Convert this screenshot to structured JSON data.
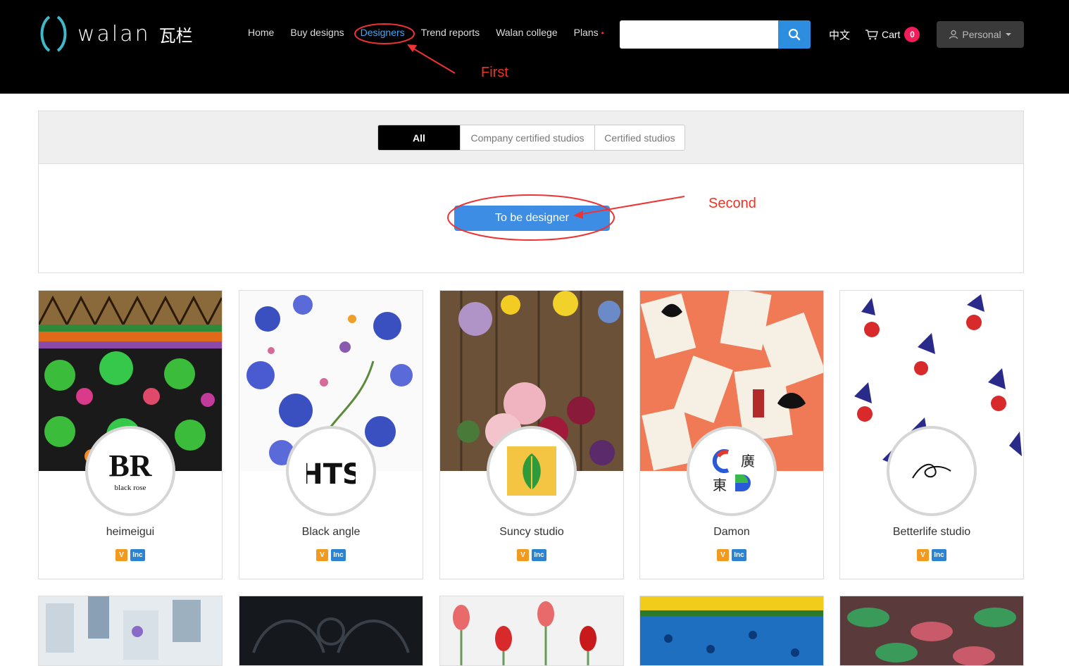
{
  "header": {
    "logo_text": "walan",
    "logo_cn": "瓦栏",
    "nav": [
      {
        "label": "Home"
      },
      {
        "label": "Buy designs"
      },
      {
        "label": "Designers"
      },
      {
        "label": "Trend reports"
      },
      {
        "label": "Walan college"
      },
      {
        "label": "Plans"
      }
    ],
    "plans_dot": "•",
    "search_placeholder": "",
    "lang": "中文",
    "cart_label": "Cart",
    "cart_count": "0",
    "personal_label": "Personal"
  },
  "annotations": {
    "first": "First",
    "second": "Second"
  },
  "filter": {
    "tabs": [
      {
        "label": "All"
      },
      {
        "label": "Company certified studios"
      },
      {
        "label": "Certified studios"
      }
    ],
    "to_be_designer": "To be designer"
  },
  "designers": [
    {
      "name": "heimeigui",
      "logo": "black rose",
      "logo_mark": "BR",
      "badge_v": "V",
      "badge_inc": "Inc"
    },
    {
      "name": "Black angle",
      "logo_mark": "HTS",
      "badge_v": "V",
      "badge_inc": "Inc"
    },
    {
      "name": "Suncy studio",
      "badge_v": "V",
      "badge_inc": "Inc"
    },
    {
      "name": "Damon",
      "badge_v": "V",
      "badge_inc": "Inc"
    },
    {
      "name": "Betterlife studio",
      "badge_v": "V",
      "badge_inc": "Inc"
    }
  ],
  "colors": {
    "accent": "#3e8de5",
    "header_bg": "#000000",
    "annotation": "#ee3322",
    "badge_v": "#f39a1e",
    "badge_inc": "#2c83d2"
  }
}
